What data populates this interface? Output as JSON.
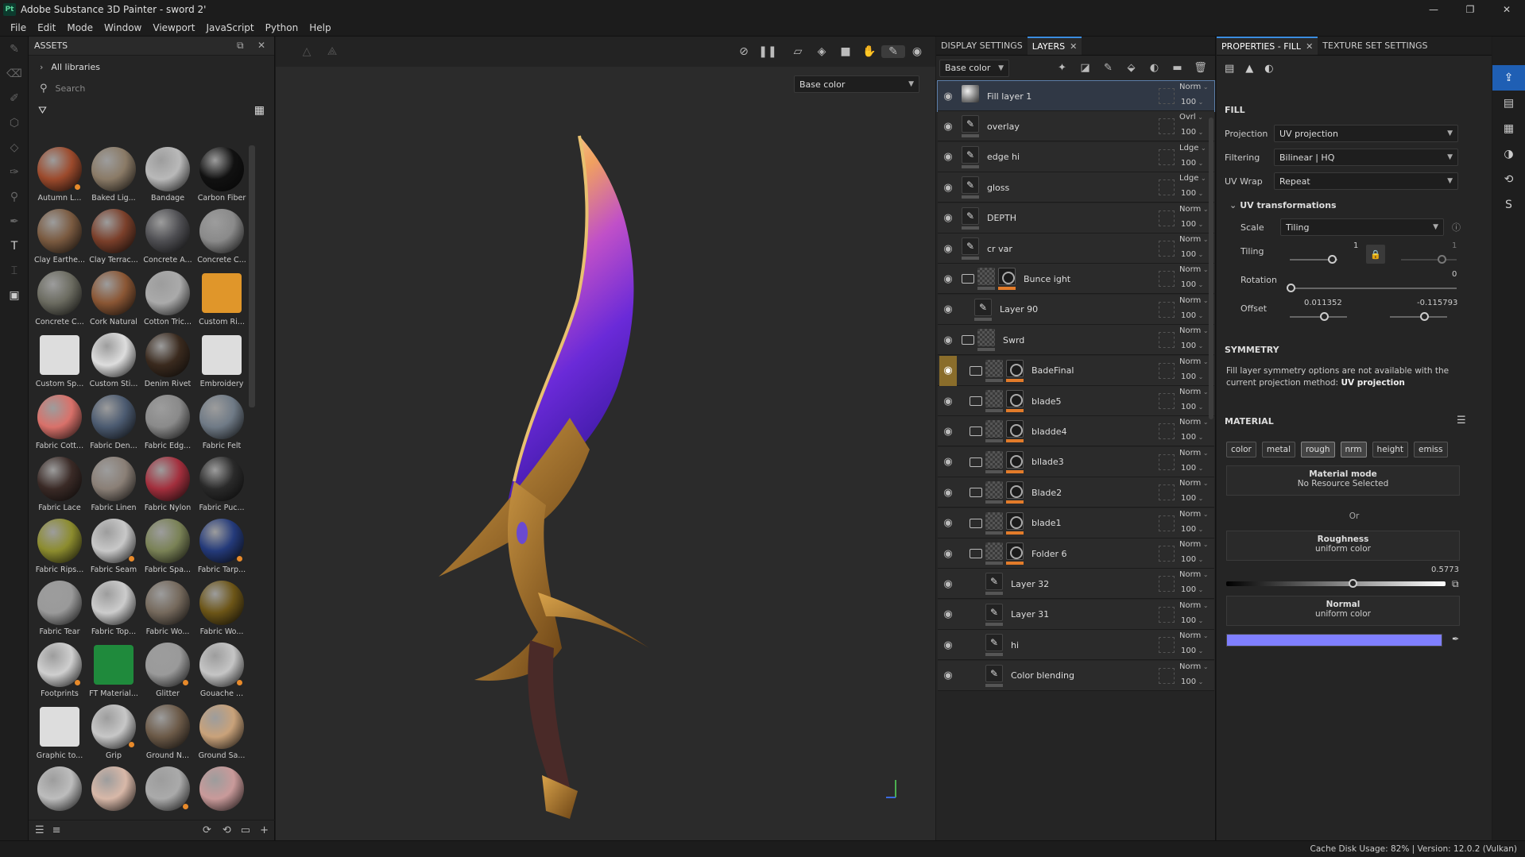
{
  "window": {
    "app_icon": "Pt",
    "title": "Adobe Substance 3D Painter - sword 2'",
    "minimize": "—",
    "maximize": "❐",
    "close": "✕"
  },
  "menu": [
    "File",
    "Edit",
    "Mode",
    "Window",
    "Viewport",
    "JavaScript",
    "Python",
    "Help"
  ],
  "assets": {
    "title": "ASSETS",
    "all_libraries": "All libraries",
    "search_placeholder": "Search",
    "items": [
      {
        "label": "Autumn L...",
        "color": "#9c4a2c",
        "dot": true
      },
      {
        "label": "Baked Lig...",
        "color": "#8a7a66"
      },
      {
        "label": "Bandage",
        "color": "#b9b9b9"
      },
      {
        "label": "Carbon Fiber",
        "color": "#111111"
      },
      {
        "label": "Clay Earthe...",
        "color": "#7a5a40"
      },
      {
        "label": "Clay Terrac...",
        "color": "#7a3f2a"
      },
      {
        "label": "Concrete A...",
        "color": "#4e4e52"
      },
      {
        "label": "Concrete C...",
        "color": "#8a8a8a"
      },
      {
        "label": "Concrete C...",
        "color": "#6b6b60"
      },
      {
        "label": "Cork Natural",
        "color": "#8a5634"
      },
      {
        "label": "Cotton Tric...",
        "color": "#aaaaaa"
      },
      {
        "label": "Custom Ri...",
        "color": "#e0962a",
        "square": true
      },
      {
        "label": "Custom Sp...",
        "color": "#dddddd",
        "square": true
      },
      {
        "label": "Custom Sti...",
        "color": "#dddddd"
      },
      {
        "label": "Denim Rivet",
        "color": "#3a2a1e"
      },
      {
        "label": "Embroidery",
        "color": "#dddddd",
        "square": true
      },
      {
        "label": "Fabric Cott...",
        "color": "#d9716a"
      },
      {
        "label": "Fabric Den...",
        "color": "#4b5a70"
      },
      {
        "label": "Fabric Edg...",
        "color": "#8a8a8a"
      },
      {
        "label": "Fabric Felt",
        "color": "#6f7a86"
      },
      {
        "label": "Fabric Lace",
        "color": "#3a2a26"
      },
      {
        "label": "Fabric Linen",
        "color": "#8a7f76"
      },
      {
        "label": "Fabric Nylon",
        "color": "#a32f3d"
      },
      {
        "label": "Fabric Puc...",
        "color": "#2a2a2a"
      },
      {
        "label": "Fabric Rips...",
        "color": "#8c8c2e"
      },
      {
        "label": "Fabric Seam",
        "color": "#c8c8c8",
        "dot": true
      },
      {
        "label": "Fabric Spa...",
        "color": "#7a8256"
      },
      {
        "label": "Fabric Tarp...",
        "color": "#243a7a",
        "dot": true
      },
      {
        "label": "Fabric Tear",
        "color": "#9a9a9a"
      },
      {
        "label": "Fabric Top...",
        "color": "#cccccc"
      },
      {
        "label": "Fabric Wo...",
        "color": "#75695c"
      },
      {
        "label": "Fabric Wo...",
        "color": "#6c5517"
      },
      {
        "label": "Footprints",
        "color": "#cfcfcf",
        "dot": true
      },
      {
        "label": "FT Material...",
        "color": "#1f8a3c",
        "square": true
      },
      {
        "label": "Glitter",
        "color": "#9a9a9a",
        "dot": true
      },
      {
        "label": "Gouache ...",
        "color": "#c5c5c5",
        "dot": true
      },
      {
        "label": "Graphic to...",
        "color": "#dddddd",
        "square": true
      },
      {
        "label": "Grip",
        "color": "#c7c7c7",
        "dot": true
      },
      {
        "label": "Ground N...",
        "color": "#6c5a48"
      },
      {
        "label": "Ground Sa...",
        "color": "#c9a27a"
      },
      {
        "label": "",
        "color": "#bdbdbd"
      },
      {
        "label": "",
        "color": "#d8b8a8"
      },
      {
        "label": "",
        "color": "#aaaaaa",
        "dot": true
      },
      {
        "label": "",
        "color": "#c99a9a"
      }
    ]
  },
  "viewport": {
    "channel": "Base color"
  },
  "layers_panel": {
    "tab_display": "DISPLAY SETTINGS",
    "tab_layers": "LAYERS",
    "channel": "Base color",
    "rows": [
      {
        "name": "Fill layer 1",
        "blend": "Norm",
        "opacity": "100",
        "type": "fill",
        "selected": true
      },
      {
        "name": "overlay",
        "blend": "Ovrl",
        "opacity": "100",
        "type": "paint"
      },
      {
        "name": "edge hi",
        "blend": "Ldge",
        "opacity": "100",
        "type": "paint"
      },
      {
        "name": "gloss",
        "blend": "Ldge",
        "opacity": "100",
        "type": "paint"
      },
      {
        "name": "DEPTH",
        "blend": "Norm",
        "opacity": "100",
        "type": "paint"
      },
      {
        "name": "cr var",
        "blend": "Norm",
        "opacity": "100",
        "type": "paint"
      },
      {
        "name": "Bunce ight",
        "blend": "Norm",
        "opacity": "100",
        "type": "folder-mask"
      },
      {
        "name": "Layer 90",
        "blend": "Norm",
        "opacity": "100",
        "type": "paint-indent"
      },
      {
        "name": "Swrd",
        "blend": "Norm",
        "opacity": "100",
        "type": "folder"
      },
      {
        "name": "BadeFinal",
        "blend": "Norm",
        "opacity": "100",
        "type": "subfolder",
        "highlight": true
      },
      {
        "name": "blade5",
        "blend": "Norm",
        "opacity": "100",
        "type": "subfolder"
      },
      {
        "name": "bladde4",
        "blend": "Norm",
        "opacity": "100",
        "type": "subfolder"
      },
      {
        "name": "bllade3",
        "blend": "Norm",
        "opacity": "100",
        "type": "subfolder"
      },
      {
        "name": "Blade2",
        "blend": "Norm",
        "opacity": "100",
        "type": "subfolder"
      },
      {
        "name": "blade1",
        "blend": "Norm",
        "opacity": "100",
        "type": "subfolder"
      },
      {
        "name": "Folder 6",
        "blend": "Norm",
        "opacity": "100",
        "type": "subfolder"
      },
      {
        "name": "Layer 32",
        "blend": "Norm",
        "opacity": "100",
        "type": "paint-indent2"
      },
      {
        "name": "Layer 31",
        "blend": "Norm",
        "opacity": "100",
        "type": "paint-indent2"
      },
      {
        "name": "hi",
        "blend": "Norm",
        "opacity": "100",
        "type": "paint-indent2"
      },
      {
        "name": "Color blending",
        "blend": "Norm",
        "opacity": "100",
        "type": "paint-indent2"
      }
    ]
  },
  "properties": {
    "tab_props": "PROPERTIES - FILL",
    "tab_texset": "TEXTURE SET SETTINGS",
    "fill_title": "FILL",
    "projection_label": "Projection",
    "projection": "UV projection",
    "filtering_label": "Filtering",
    "filtering": "Bilinear | HQ",
    "uvwrap_label": "UV Wrap",
    "uvwrap": "Repeat",
    "uvtrans_title": "UV transformations",
    "scale_label": "Scale",
    "scale": "Tiling",
    "tiling_label": "Tiling",
    "tiling_value": "1",
    "tiling_value2": "1",
    "rotation_label": "Rotation",
    "rotation_value": "0",
    "offset_label": "Offset",
    "offset_u": "0.011352",
    "offset_v": "-0.115793",
    "symmetry_title": "SYMMETRY",
    "symmetry_text": "Fill layer symmetry options are not available with the current projection method:",
    "symmetry_method": "UV projection",
    "material_title": "MATERIAL",
    "channels": [
      "color",
      "metal",
      "rough",
      "nrm",
      "height",
      "emiss"
    ],
    "material_mode_title": "Material mode",
    "material_mode_value": "No Resource Selected",
    "or": "Or",
    "roughness_title": "Roughness",
    "roughness_sub": "uniform color",
    "roughness_value": "0.5773",
    "normal_title": "Normal",
    "normal_sub": "uniform color",
    "normal_color": "#7f7fff"
  },
  "status": "Cache Disk Usage:   82% | Version: 12.0.2 (Vulkan)"
}
